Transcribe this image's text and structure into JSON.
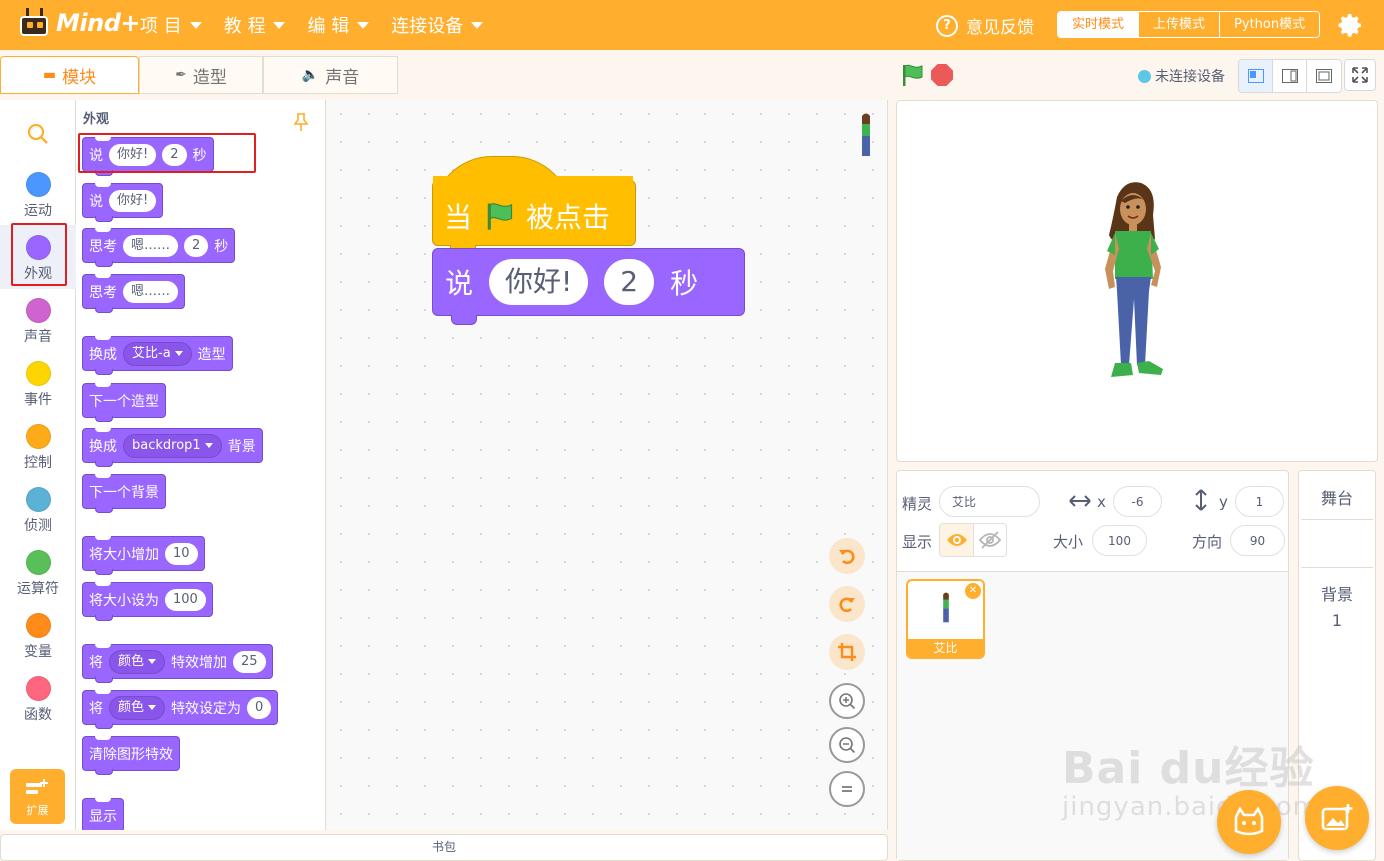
{
  "app": {
    "logo_text": "Mind+"
  },
  "menu": [
    {
      "label": "项 目"
    },
    {
      "label": "教 程"
    },
    {
      "label": "编 辑"
    },
    {
      "label": "连接设备"
    }
  ],
  "header": {
    "feedback_label": "意见反馈",
    "modes": [
      {
        "label": "实时模式",
        "active": true
      },
      {
        "label": "上传模式",
        "active": false
      },
      {
        "label": "Python模式",
        "active": false
      }
    ]
  },
  "tabs": [
    {
      "label": "模块",
      "active": true,
      "icon": "blocks-icon"
    },
    {
      "label": "造型",
      "active": false,
      "icon": "brush-icon"
    },
    {
      "label": "声音",
      "active": false,
      "icon": "speaker-icon"
    }
  ],
  "stage_header": {
    "connection_status": "未连接设备"
  },
  "categories": [
    {
      "label": "运动",
      "color": "#4c97ff"
    },
    {
      "label": "外观",
      "color": "#9966ff",
      "selected": true
    },
    {
      "label": "声音",
      "color": "#cf63cf"
    },
    {
      "label": "事件",
      "color": "#ffd500"
    },
    {
      "label": "控制",
      "color": "#ffab19"
    },
    {
      "label": "侦测",
      "color": "#5cb1d6"
    },
    {
      "label": "运算符",
      "color": "#59c059"
    },
    {
      "label": "变量",
      "color": "#ff8c1a"
    },
    {
      "label": "函数",
      "color": "#ff6680"
    }
  ],
  "extension_label": "扩展",
  "palette": {
    "title": "外观",
    "blocks": {
      "say_secs": {
        "say": "说",
        "msg": "你好!",
        "secs": "2",
        "unit": "秒"
      },
      "say": {
        "say": "说",
        "msg": "你好!"
      },
      "think_secs": {
        "think": "思考",
        "msg": "嗯……",
        "secs": "2",
        "unit": "秒"
      },
      "think": {
        "think": "思考",
        "msg": "嗯……"
      },
      "switch_costume": {
        "pre": "换成",
        "val": "艾比-a",
        "post": "造型"
      },
      "next_costume": {
        "text": "下一个造型"
      },
      "switch_backdrop": {
        "pre": "换成",
        "val": "backdrop1",
        "post": "背景"
      },
      "next_backdrop": {
        "text": "下一个背景"
      },
      "change_size": {
        "text": "将大小增加",
        "val": "10"
      },
      "set_size": {
        "text": "将大小设为",
        "val": "100"
      },
      "change_effect": {
        "pre": "将",
        "effect": "颜色",
        "post": "特效增加",
        "val": "25"
      },
      "set_effect": {
        "pre": "将",
        "effect": "颜色",
        "post": "特效设定为",
        "val": "0"
      },
      "clear_effects": {
        "text": "清除图形特效"
      },
      "show": {
        "text": "显示"
      }
    }
  },
  "script": {
    "hat": {
      "pre": "当",
      "post": "被点击"
    },
    "say": {
      "say": "说",
      "msg": "你好!",
      "secs": "2",
      "unit": "秒"
    }
  },
  "backpack_label": "书包",
  "sprite_info": {
    "sprite_label": "精灵",
    "sprite_name": "艾比",
    "x_label": "x",
    "x": "-6",
    "y_label": "y",
    "y": "1",
    "show_label": "显示",
    "size_label": "大小",
    "size": "100",
    "direction_label": "方向",
    "direction": "90"
  },
  "sprites": [
    {
      "name": "艾比",
      "selected": true
    }
  ],
  "stage_selector": {
    "title": "舞台",
    "backdrop_label": "背景",
    "backdrop_count": "1"
  },
  "watermark": {
    "main": "Bai du经验",
    "sub": "jingyan.baidu.com"
  },
  "colors": {
    "accent": "#ffae2d",
    "looks": "#9966ff",
    "events": "#ffbf00",
    "highlight": "#e02020"
  }
}
